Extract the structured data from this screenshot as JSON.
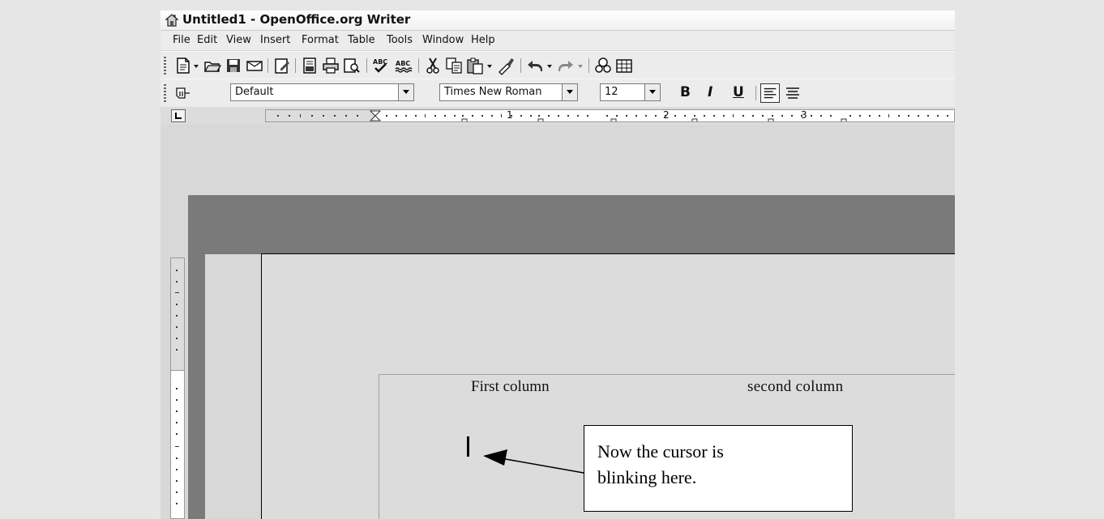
{
  "window": {
    "title": "Untitled1 - OpenOffice.org Writer"
  },
  "menu": [
    {
      "label": "File"
    },
    {
      "label": "Edit"
    },
    {
      "label": "View"
    },
    {
      "label": "Insert"
    },
    {
      "label": "Format"
    },
    {
      "label": "Table"
    },
    {
      "label": "Tools"
    },
    {
      "label": "Window"
    },
    {
      "label": "Help"
    }
  ],
  "toolbar_standard": {
    "icons": [
      "new-document-icon",
      "open-icon",
      "save-icon",
      "email-icon",
      "edit-file-icon",
      "export-pdf-icon",
      "print-icon",
      "page-preview-icon",
      "spellcheck-icon",
      "autospellcheck-icon",
      "cut-icon",
      "copy-icon",
      "paste-icon",
      "clone-formatting-icon",
      "undo-icon",
      "redo-icon",
      "navigator-icon",
      "table-icon"
    ]
  },
  "toolbar_formatting": {
    "style_value": "Default",
    "font_value": "Times New Roman",
    "size_value": "12",
    "bold_label": "B",
    "italic_label": "I",
    "underline_label": "U"
  },
  "ruler": {
    "numbers": [
      "1",
      "2",
      "3"
    ]
  },
  "document": {
    "column1": "First column",
    "column2": "second column"
  },
  "callout": {
    "line1": "Now the cursor is",
    "line2": "blinking here."
  }
}
